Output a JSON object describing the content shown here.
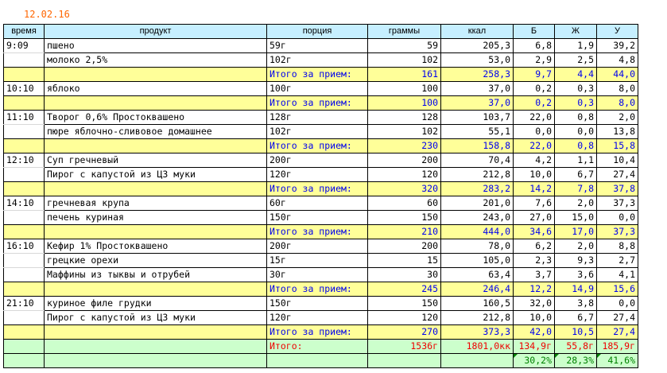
{
  "date": "12.02.16",
  "headers": [
    "время",
    "продукт",
    "порция",
    "граммы",
    "ккал",
    "Б",
    "Ж",
    "У"
  ],
  "subtotal_label": "Итого за прием:",
  "rows": [
    {
      "type": "item",
      "time": "9:09",
      "product": "пшено",
      "portion": "59г",
      "grams": "59",
      "kcal": "205,3",
      "b": "6,8",
      "zh": "1,9",
      "u": "39,2"
    },
    {
      "type": "item",
      "time": "",
      "product": "молоко 2,5%",
      "portion": "102г",
      "grams": "102",
      "kcal": "53,0",
      "b": "2,9",
      "zh": "2,5",
      "u": "4,8"
    },
    {
      "type": "sub",
      "grams": "161",
      "kcal": "258,3",
      "b": "9,7",
      "zh": "4,4",
      "u": "44,0"
    },
    {
      "type": "item",
      "time": "10:10",
      "product": "яблоко",
      "portion": "100г",
      "grams": "100",
      "kcal": "37,0",
      "b": "0,2",
      "zh": "0,3",
      "u": "8,0"
    },
    {
      "type": "sub",
      "grams": "100",
      "kcal": "37,0",
      "b": "0,2",
      "zh": "0,3",
      "u": "8,0"
    },
    {
      "type": "item",
      "time": "11:10",
      "product": "Творог 0,6% Простоквашено",
      "portion": "128г",
      "grams": "128",
      "kcal": "103,7",
      "b": "22,0",
      "zh": "0,8",
      "u": "2,0"
    },
    {
      "type": "item",
      "time": "",
      "product": "пюре яблочно-сливовое домашнее",
      "portion": "102г",
      "grams": "102",
      "kcal": "55,1",
      "b": "0,0",
      "zh": "0,0",
      "u": "13,8"
    },
    {
      "type": "sub",
      "grams": "230",
      "kcal": "158,8",
      "b": "22,0",
      "zh": "0,8",
      "u": "15,8"
    },
    {
      "type": "item",
      "time": "12:10",
      "product": "Суп гречневый",
      "portion": "200г",
      "grams": "200",
      "kcal": "70,4",
      "b": "4,2",
      "zh": "1,1",
      "u": "10,4"
    },
    {
      "type": "item",
      "time": "",
      "product": "Пирог с капустой из ЦЗ муки",
      "portion": "120г",
      "grams": "120",
      "kcal": "212,8",
      "b": "10,0",
      "zh": "6,7",
      "u": "27,4"
    },
    {
      "type": "sub",
      "grams": "320",
      "kcal": "283,2",
      "b": "14,2",
      "zh": "7,8",
      "u": "37,8"
    },
    {
      "type": "item",
      "time": "14:10",
      "product": "гречневая крупа",
      "portion": "60г",
      "grams": "60",
      "kcal": "201,0",
      "b": "7,6",
      "zh": "2,0",
      "u": "37,3"
    },
    {
      "type": "item",
      "time": "",
      "product": "печень куриная",
      "portion": "150г",
      "grams": "150",
      "kcal": "243,0",
      "b": "27,0",
      "zh": "15,0",
      "u": "0,0"
    },
    {
      "type": "sub",
      "grams": "210",
      "kcal": "444,0",
      "b": "34,6",
      "zh": "17,0",
      "u": "37,3"
    },
    {
      "type": "item",
      "time": "16:10",
      "product": "Кефир 1% Простоквашено",
      "portion": "200г",
      "grams": "200",
      "kcal": "78,0",
      "b": "6,2",
      "zh": "2,0",
      "u": "8,8"
    },
    {
      "type": "item",
      "time": "",
      "product": "грецкие орехи",
      "portion": "15г",
      "grams": "15",
      "kcal": "105,0",
      "b": "2,3",
      "zh": "9,3",
      "u": "2,7"
    },
    {
      "type": "item",
      "time": "",
      "product": "Маффины из тыквы и отрубей",
      "portion": "30г",
      "grams": "30",
      "kcal": "63,4",
      "b": "3,7",
      "zh": "3,6",
      "u": "4,1"
    },
    {
      "type": "sub",
      "grams": "245",
      "kcal": "246,4",
      "b": "12,2",
      "zh": "14,9",
      "u": "15,6"
    },
    {
      "type": "item",
      "time": "21:10",
      "product": "куриное филе грудки",
      "portion": "150г",
      "grams": "150",
      "kcal": "160,5",
      "b": "32,0",
      "zh": "3,8",
      "u": "0,0"
    },
    {
      "type": "item",
      "time": "",
      "product": "Пирог с капустой из ЦЗ муки",
      "portion": "120г",
      "grams": "120",
      "kcal": "212,8",
      "b": "10,0",
      "zh": "6,7",
      "u": "27,4"
    },
    {
      "type": "sub",
      "grams": "270",
      "kcal": "373,3",
      "b": "42,0",
      "zh": "10,5",
      "u": "27,4"
    }
  ],
  "total": {
    "label": "Итого:",
    "grams": "1536г",
    "kcal": "1801,0кк",
    "b": "134,9г",
    "zh": "55,8г",
    "u": "185,9г"
  },
  "percent": {
    "b": "30,2%",
    "zh": "28,3%",
    "u": "41,6%"
  }
}
